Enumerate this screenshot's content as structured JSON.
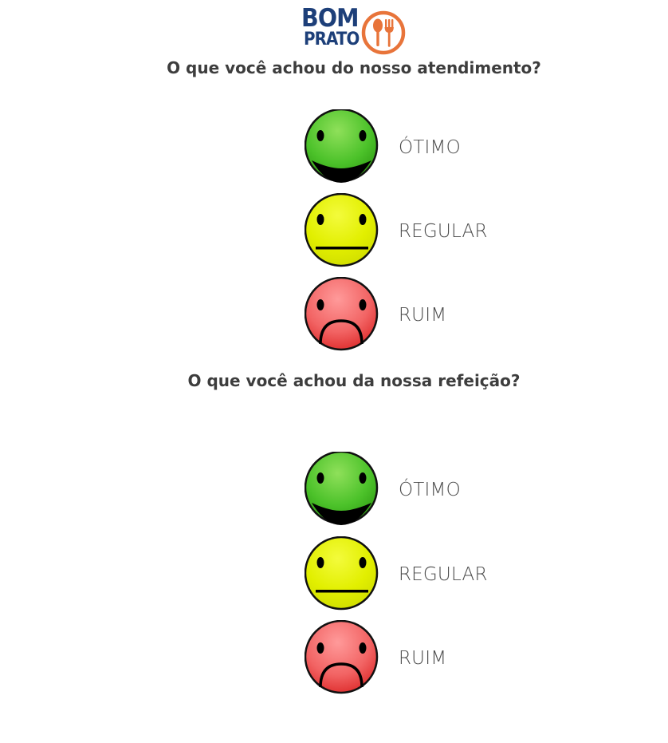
{
  "logo": {
    "line1": "BOM",
    "line2": "PRATO",
    "brand_blue": "#1d3f79",
    "brand_orange": "#e8743a",
    "icon": "spoon-fork-icon"
  },
  "survey": {
    "questions": [
      {
        "text": "O que você achou do nosso atendimento?",
        "options": [
          {
            "label": "ÓTIMO",
            "icon": "happy-face-icon",
            "color": "#3fbf1e"
          },
          {
            "label": "REGULAR",
            "icon": "neutral-face-icon",
            "color": "#e3f000"
          },
          {
            "label": "RUIM",
            "icon": "sad-face-icon",
            "color": "#f06a6a"
          }
        ]
      },
      {
        "text": "O que você achou da nossa refeição?",
        "options": [
          {
            "label": "ÓTIMO",
            "icon": "happy-face-icon",
            "color": "#3fbf1e"
          },
          {
            "label": "REGULAR",
            "icon": "neutral-face-icon",
            "color": "#e3f000"
          },
          {
            "label": "RUIM",
            "icon": "sad-face-icon",
            "color": "#f06a6a"
          }
        ]
      }
    ]
  }
}
